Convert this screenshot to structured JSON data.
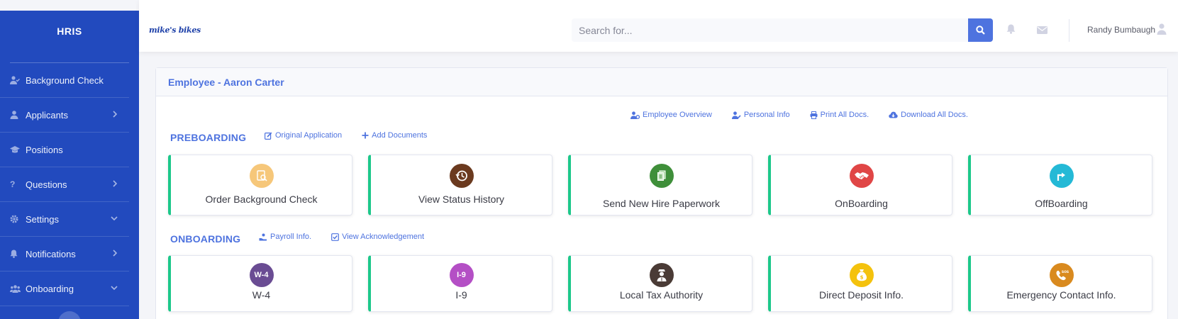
{
  "sidebar": {
    "brand": "HRIS",
    "items": [
      {
        "label": "Background Check",
        "icon": "user-check-icon",
        "chevron": ""
      },
      {
        "label": "Applicants",
        "icon": "user-icon",
        "chevron": "right"
      },
      {
        "label": "Positions",
        "icon": "graduation-cap-icon",
        "chevron": ""
      },
      {
        "label": "Questions",
        "icon": "question-icon",
        "chevron": "right"
      },
      {
        "label": "Settings",
        "icon": "gear-icon",
        "chevron": "down"
      },
      {
        "label": "Notifications",
        "icon": "bell-icon",
        "chevron": "right"
      },
      {
        "label": "Onboarding",
        "icon": "users-icon",
        "chevron": "down"
      }
    ]
  },
  "topbar": {
    "logo_text": "mike's bikes",
    "search_placeholder": "Search for...",
    "username": "Randy Bumbaugh"
  },
  "card": {
    "title": "Employee - Aaron Carter",
    "top_links": [
      "Employee Overview",
      "Personal Info",
      "Print All Docs.",
      "Download All Docs."
    ],
    "preboarding": {
      "title": "PREBOARDING",
      "links": [
        "Original Application",
        "Add Documents"
      ],
      "tiles": [
        {
          "label": "Order Background Check",
          "icon": "background-check-icon",
          "color": "#f6c77a",
          "text": ""
        },
        {
          "label": "View Status History",
          "icon": "history-icon",
          "color": "#6b3a1f",
          "text": ""
        },
        {
          "label": "Send New Hire Paperwork",
          "icon": "paperwork-icon",
          "color": "#3f8f3a",
          "text": ""
        },
        {
          "label": "OnBoarding",
          "icon": "handshake-icon",
          "color": "#e04646",
          "text": ""
        },
        {
          "label": "OffBoarding",
          "icon": "exit-arrow-icon",
          "color": "#24b9d6",
          "text": ""
        }
      ]
    },
    "onboarding": {
      "title": "ONBOARDING",
      "links": [
        "Payroll Info.",
        "View Acknowledgement"
      ],
      "tiles": [
        {
          "label": "W-4",
          "icon": "w4-icon",
          "color": "#6a4c93",
          "text": "W-4"
        },
        {
          "label": "I-9",
          "icon": "i9-icon",
          "color": "#b44fc5",
          "text": "I-9"
        },
        {
          "label": "Local Tax Authority",
          "icon": "officer-icon",
          "color": "#4a3b36",
          "text": ""
        },
        {
          "label": "Direct Deposit Info.",
          "icon": "money-bag-icon",
          "color": "#f4c20d",
          "text": ""
        },
        {
          "label": "Emergency Contact Info.",
          "icon": "sos-phone-icon",
          "color": "#d98a1f",
          "text": ""
        }
      ]
    }
  }
}
